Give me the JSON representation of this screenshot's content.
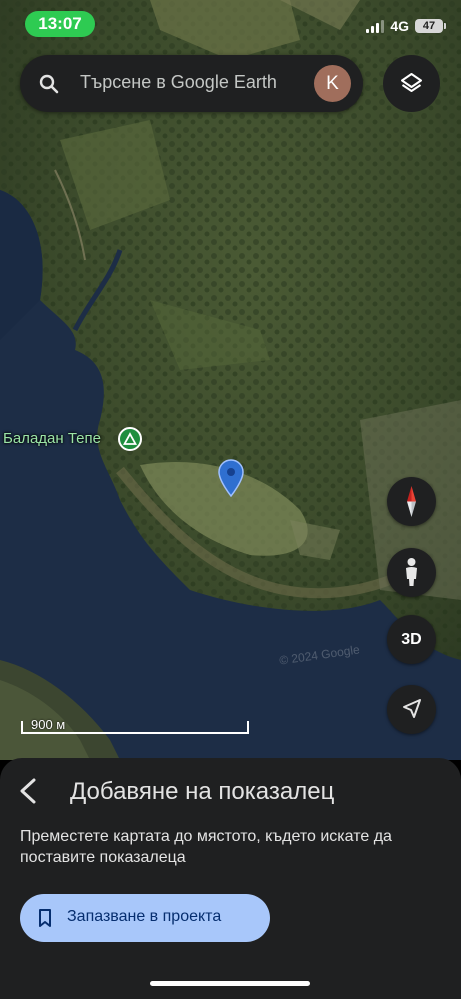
{
  "status_bar": {
    "time": "13:07",
    "network": "4G",
    "battery": "47",
    "colors": {
      "time_pill": "#2ecb52"
    }
  },
  "search": {
    "placeholder": "Търсене в Google Earth",
    "avatar_initial": "K",
    "icons": [
      "search-icon",
      "layers-icon"
    ]
  },
  "map": {
    "place_label": "Баладан Тепе",
    "place_icon": "trail-icon",
    "watermark": "© 2024 Google",
    "scale_label": "900 м",
    "controls": {
      "compass": "compass-icon",
      "street_view": "pegman-icon",
      "view_3d": "3D",
      "my_location": "navigation-arrow-icon"
    },
    "colors": {
      "water": "#1c2c46",
      "forest": "#3a4a2a",
      "pin": "#2f6fd0"
    }
  },
  "sheet": {
    "title": "Добавяне на показалец",
    "description": "Преместете картата до мястото, където искате да поставите показалеца",
    "save_button": "Запазване в проекта",
    "icons": [
      "back-arrow-icon",
      "bookmark-icon"
    ],
    "colors": {
      "background": "#1f2021",
      "button": "#a8c7fa",
      "button_text": "#062e6f"
    }
  }
}
